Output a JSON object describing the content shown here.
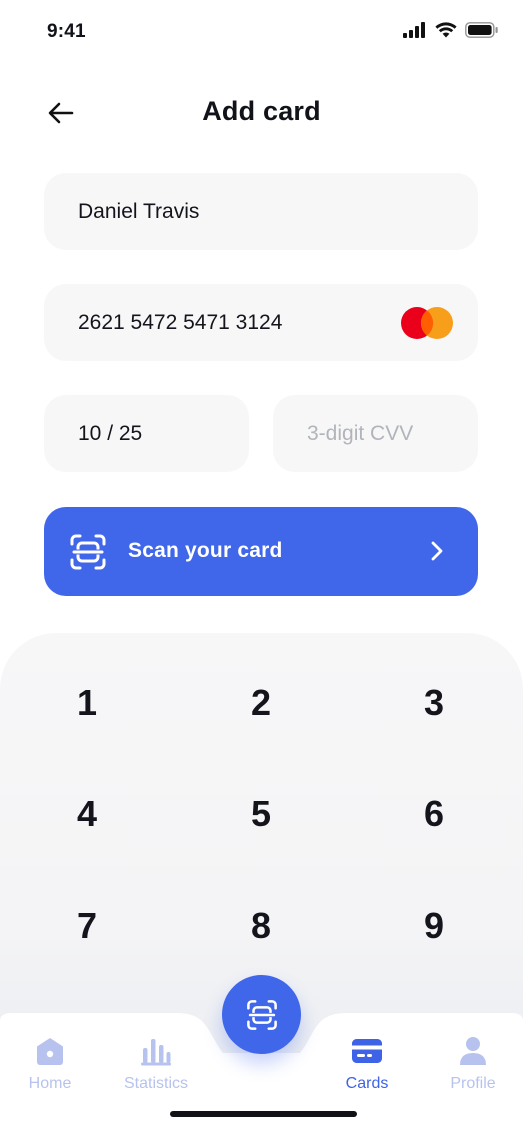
{
  "status_bar": {
    "time": "9:41"
  },
  "header": {
    "title": "Add card"
  },
  "form": {
    "cardholder_name": "Daniel Travis",
    "card_number": "2621 5472 5471 3124",
    "expiry": "10 / 25",
    "cvv_placeholder": "3-digit CVV",
    "card_brand_icon": "mastercard-logo"
  },
  "scan_button": {
    "label": "Scan your card",
    "icon": "scan-card-icon",
    "chevron": "chevron-right-icon"
  },
  "keypad": {
    "keys": [
      "1",
      "2",
      "3",
      "4",
      "5",
      "6",
      "7",
      "8",
      "9"
    ]
  },
  "tab_bar": {
    "tabs": [
      {
        "label": "Home",
        "icon": "home-icon",
        "active": false
      },
      {
        "label": "Statistics",
        "icon": "statistics-icon",
        "active": false
      },
      {
        "label": "Cards",
        "icon": "card-icon",
        "active": true
      },
      {
        "label": "Profile",
        "icon": "profile-icon",
        "active": false
      }
    ],
    "center_action_icon": "scan-card-icon"
  },
  "colors": {
    "accent": "#4066e9",
    "tab_inactive": "#b7c3ee",
    "field_bg": "#f7f7f8",
    "placeholder": "#b2b4bc",
    "mastercard_red": "#eb001b",
    "mastercard_orange": "#f79e1b"
  }
}
